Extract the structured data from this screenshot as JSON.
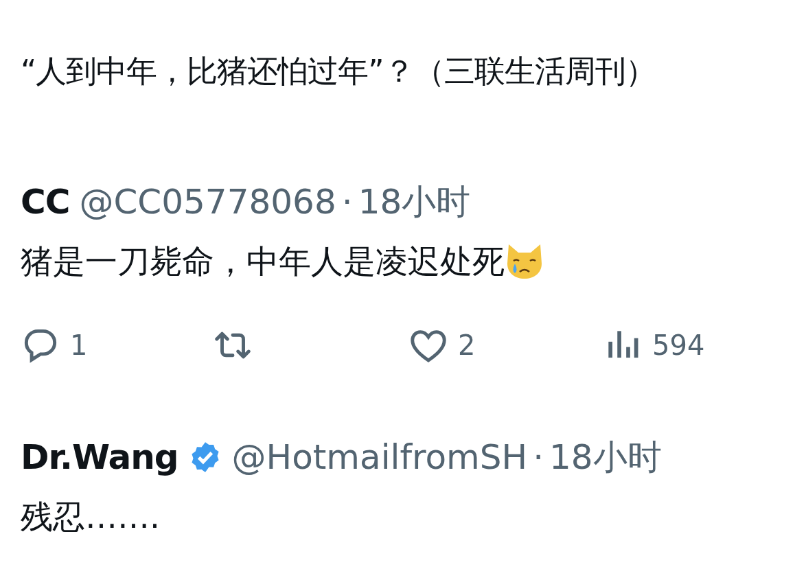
{
  "headline": "“人到中年，比猪还怕过年”？（三联生活周刊）",
  "replies": [
    {
      "name": "CC",
      "verified": false,
      "handle": "@CC05778068",
      "separator": "·",
      "time": "18小时",
      "text": "猪是一刀毙命，中年人是凌迟处死",
      "emoji_icon": true,
      "actions": [
        {
          "kind": "reply",
          "count": "1"
        },
        {
          "kind": "repost"
        },
        {
          "kind": "like",
          "count": "2"
        },
        {
          "kind": "views",
          "count": "594"
        }
      ]
    },
    {
      "name": "Dr.Wang",
      "verified": true,
      "handle": "@HotmailfromSH",
      "separator": "·",
      "time": "18小时",
      "text": "残忍……."
    }
  ]
}
